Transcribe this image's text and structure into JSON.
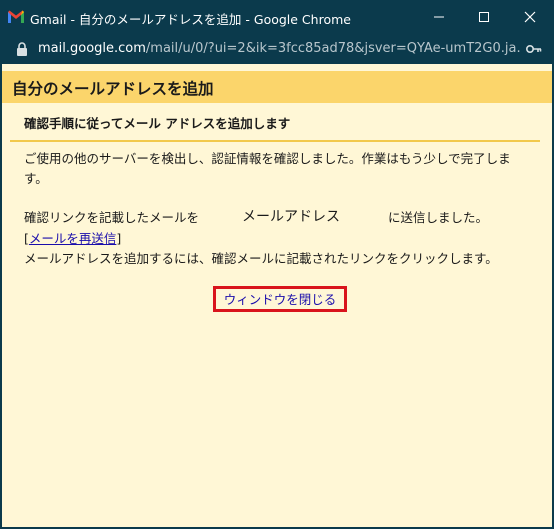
{
  "window": {
    "title": "Gmail - 自分のメールアドレスを追加 - Google Chrome",
    "url_host": "mail.google.com",
    "url_path": "/mail/u/0/?ui=2&ik=3fcc85ad78&jsver=QYAe-umT2G0.ja...."
  },
  "dialog": {
    "header": "自分のメールアドレスを追加",
    "subheader": "確認手順に従ってメール アドレスを追加します",
    "intro": "ご使用の他のサーバーを検出し、認証情報を確認しました。作業はもう少しで完了します。",
    "sent_prefix": "確認リンクを記載したメールを",
    "sent_address": "メールアドレス",
    "sent_suffix": "に送信しました。",
    "resend_open": "[",
    "resend_link": "メールを再送信",
    "resend_close": "]",
    "instruction": "メールアドレスを追加するには、確認メールに記載されたリンクをクリックします。",
    "close_link": "ウィンドウを閉じる"
  },
  "colors": {
    "titlebar": "#0b3a4c",
    "header": "#fbd56b",
    "background": "#fff7d6",
    "highlight": "#d9141c"
  }
}
